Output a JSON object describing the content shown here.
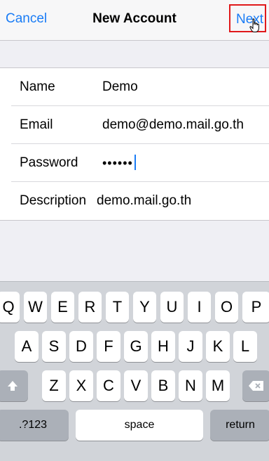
{
  "navbar": {
    "cancel_label": "Cancel",
    "title": "New Account",
    "next_label": "Next"
  },
  "form": {
    "rows": [
      {
        "label": "Name",
        "value": "Demo"
      },
      {
        "label": "Email",
        "value": "demo@demo.mail.go.th"
      },
      {
        "label": "Password",
        "value": "••••••"
      },
      {
        "label": "Description",
        "value": "demo.mail.go.th"
      }
    ]
  },
  "keyboard": {
    "row1": [
      "Q",
      "W",
      "E",
      "R",
      "T",
      "Y",
      "U",
      "I",
      "O",
      "P"
    ],
    "row2": [
      "A",
      "S",
      "D",
      "F",
      "G",
      "H",
      "J",
      "K",
      "L"
    ],
    "row3": [
      "Z",
      "X",
      "C",
      "V",
      "B",
      "N",
      "M"
    ],
    "numbers_label": ".?123",
    "space_label": "space",
    "return_label": "return"
  },
  "colors": {
    "accent": "#1a7cf5",
    "highlight_box": "#e0191b"
  }
}
